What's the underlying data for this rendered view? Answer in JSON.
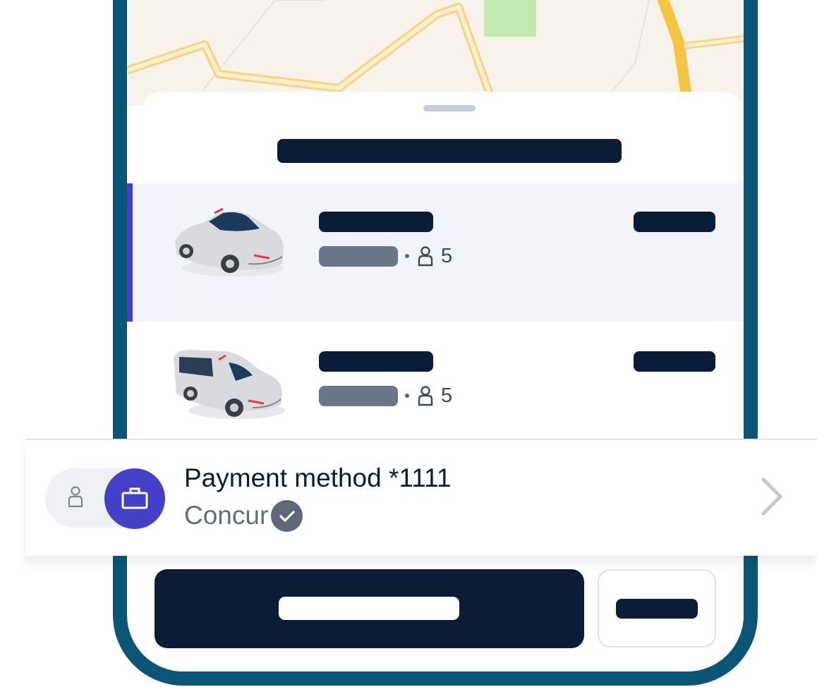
{
  "rides": [
    {
      "passengers": "5",
      "selected": true,
      "vehicle_icon": "sedan-car-icon"
    },
    {
      "passengers": "5",
      "selected": false,
      "vehicle_icon": "minivan-icon"
    }
  ],
  "payment": {
    "title": "Payment method *1111",
    "provider": "Concur",
    "mode_icons": [
      "person-icon",
      "briefcase-icon"
    ],
    "active_mode": "business"
  },
  "colors": {
    "frame": "#0b5676",
    "navy": "#0b1c36",
    "accent": "#4640c8",
    "selected_row": "#f2f3fb"
  }
}
